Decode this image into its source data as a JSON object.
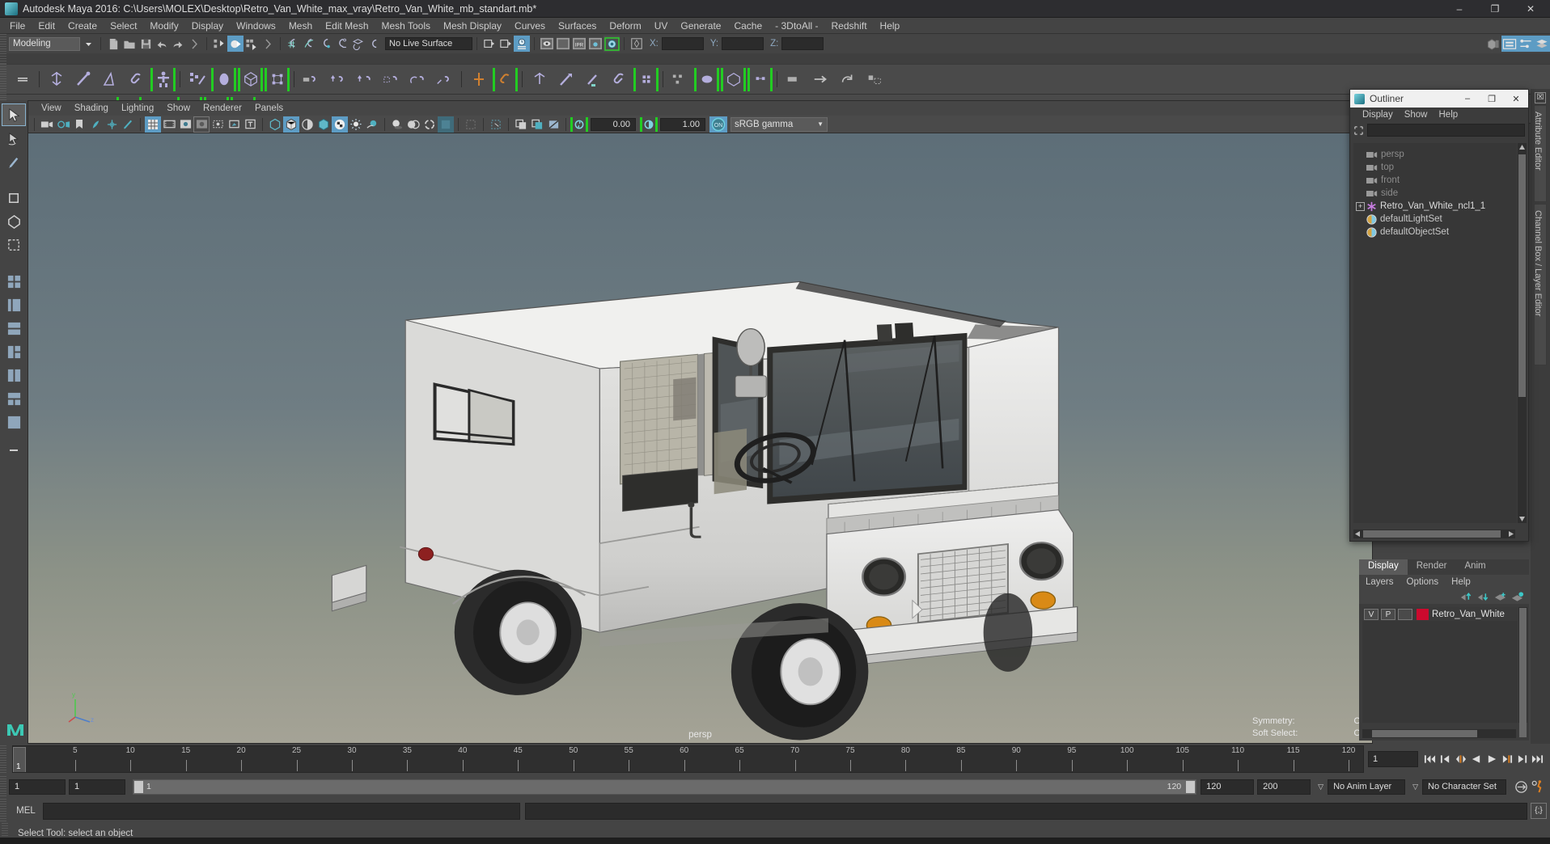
{
  "window": {
    "title": "Autodesk Maya 2016: C:\\Users\\MOLEX\\Desktop\\Retro_Van_White_max_vray\\Retro_Van_White_mb_standart.mb*",
    "minimize": "–",
    "maximize": "❐",
    "close": "✕",
    "app_icon": "maya-logo-icon"
  },
  "menubar": {
    "items": [
      "File",
      "Edit",
      "Create",
      "Select",
      "Modify",
      "Display",
      "Windows",
      "Mesh",
      "Edit Mesh",
      "Mesh Tools",
      "Mesh Display",
      "Curves",
      "Surfaces",
      "Deform",
      "UV",
      "Generate",
      "Cache",
      "- 3DtoAll -",
      "Redshift",
      "Help"
    ]
  },
  "status_bar": {
    "menu_set": "Modeling",
    "live_surface": "No Live Surface",
    "axis_x_label": "X:",
    "axis_y_label": "Y:",
    "axis_z_label": "Z:",
    "axis_x_value": "",
    "axis_y_value": "",
    "axis_z_value": "",
    "ipr_label": "IPR"
  },
  "viewport": {
    "menus": [
      "View",
      "Shading",
      "Lighting",
      "Show",
      "Renderer",
      "Panels"
    ],
    "exposure_value": "0.00",
    "gamma_value": "1.00",
    "color_mgmt_toggle": "ON",
    "view_transform": "sRGB gamma",
    "camera_label": "persp",
    "hud": [
      {
        "label": "Symmetry:",
        "value": "Off"
      },
      {
        "label": "Soft Select:",
        "value": "Off"
      }
    ]
  },
  "outliner": {
    "title": "Outliner",
    "minimize": "–",
    "maximize": "❐",
    "close": "✕",
    "menus": [
      "Display",
      "Show",
      "Help"
    ],
    "search_value": "",
    "items": [
      {
        "label": "persp",
        "icon": "camera-icon",
        "dim": true,
        "expandable": false
      },
      {
        "label": "top",
        "icon": "camera-icon",
        "dim": true,
        "expandable": false
      },
      {
        "label": "front",
        "icon": "camera-icon",
        "dim": true,
        "expandable": false
      },
      {
        "label": "side",
        "icon": "camera-icon",
        "dim": true,
        "expandable": false
      },
      {
        "label": "Retro_Van_White_ncl1_1",
        "icon": "asterisk-icon",
        "dim": false,
        "expandable": true
      },
      {
        "label": "defaultLightSet",
        "icon": "set-icon",
        "dim": false,
        "expandable": false
      },
      {
        "label": "defaultObjectSet",
        "icon": "set-icon",
        "dim": false,
        "expandable": false
      }
    ]
  },
  "right_dock": {
    "tabs": [
      "Attribute Editor",
      "Channel Box / Layer Editor"
    ],
    "close_label": "☒"
  },
  "layer_editor": {
    "tabs": [
      {
        "label": "Display",
        "active": true
      },
      {
        "label": "Render",
        "active": false
      },
      {
        "label": "Anim",
        "active": false
      }
    ],
    "menus": [
      "Layers",
      "Options",
      "Help"
    ],
    "layers": [
      {
        "visibility": "V",
        "playback": "P",
        "third": "",
        "color": "#cc0a2e",
        "name": "Retro_Van_White"
      }
    ]
  },
  "timeline": {
    "start": 1,
    "end": 120,
    "tick_step": 5,
    "ticks": [
      5,
      10,
      15,
      20,
      25,
      30,
      35,
      40,
      45,
      50,
      55,
      60,
      65,
      70,
      75,
      80,
      85,
      90,
      95,
      100,
      105,
      110,
      115,
      120
    ],
    "current_frame": "1",
    "current_frame_marker": "1",
    "playback_buttons": [
      "go-to-start-icon",
      "step-back-keyframe-icon",
      "step-back-frame-icon",
      "play-backwards-icon",
      "play-forwards-icon",
      "step-forward-frame-icon",
      "step-forward-keyframe-icon",
      "go-to-end-icon"
    ]
  },
  "range_slider": {
    "anim_start": "1",
    "playback_start": "1",
    "range_left_label": "1",
    "range_right_label": "120",
    "playback_end": "120",
    "anim_end": "200",
    "anim_layer": "No Anim Layer",
    "character_set": "No Character Set",
    "auto_key_icon": "auto-keyframe-icon",
    "anim_prefs_icon": "animation-preferences-icon"
  },
  "command_line": {
    "language": "MEL",
    "input_value": "",
    "output_value": "",
    "script_editor_icon": "script-editor-icon"
  },
  "help_line": {
    "text": "Select Tool: select an object"
  },
  "toolbox": {
    "items": [
      "select-tool",
      "lasso-select-tool",
      "paint-select-tool",
      "move-tool",
      "rotate-tool",
      "scale-tool",
      "last-tool",
      "four-view-layout",
      "persp-outliner-layout",
      "persp-graph-layout",
      "persp-poly-layout",
      "hypershade-layout",
      "two-pane-layout",
      "single-pane-layout",
      "more-layouts"
    ]
  },
  "colors": {
    "accent_blue": "#5d9cc4",
    "green_bracket": "#22cc22",
    "orange": "#e08020",
    "layer_red": "#cc0a2e",
    "panel_bg": "#444444",
    "dark_field": "#2b2b2b"
  }
}
